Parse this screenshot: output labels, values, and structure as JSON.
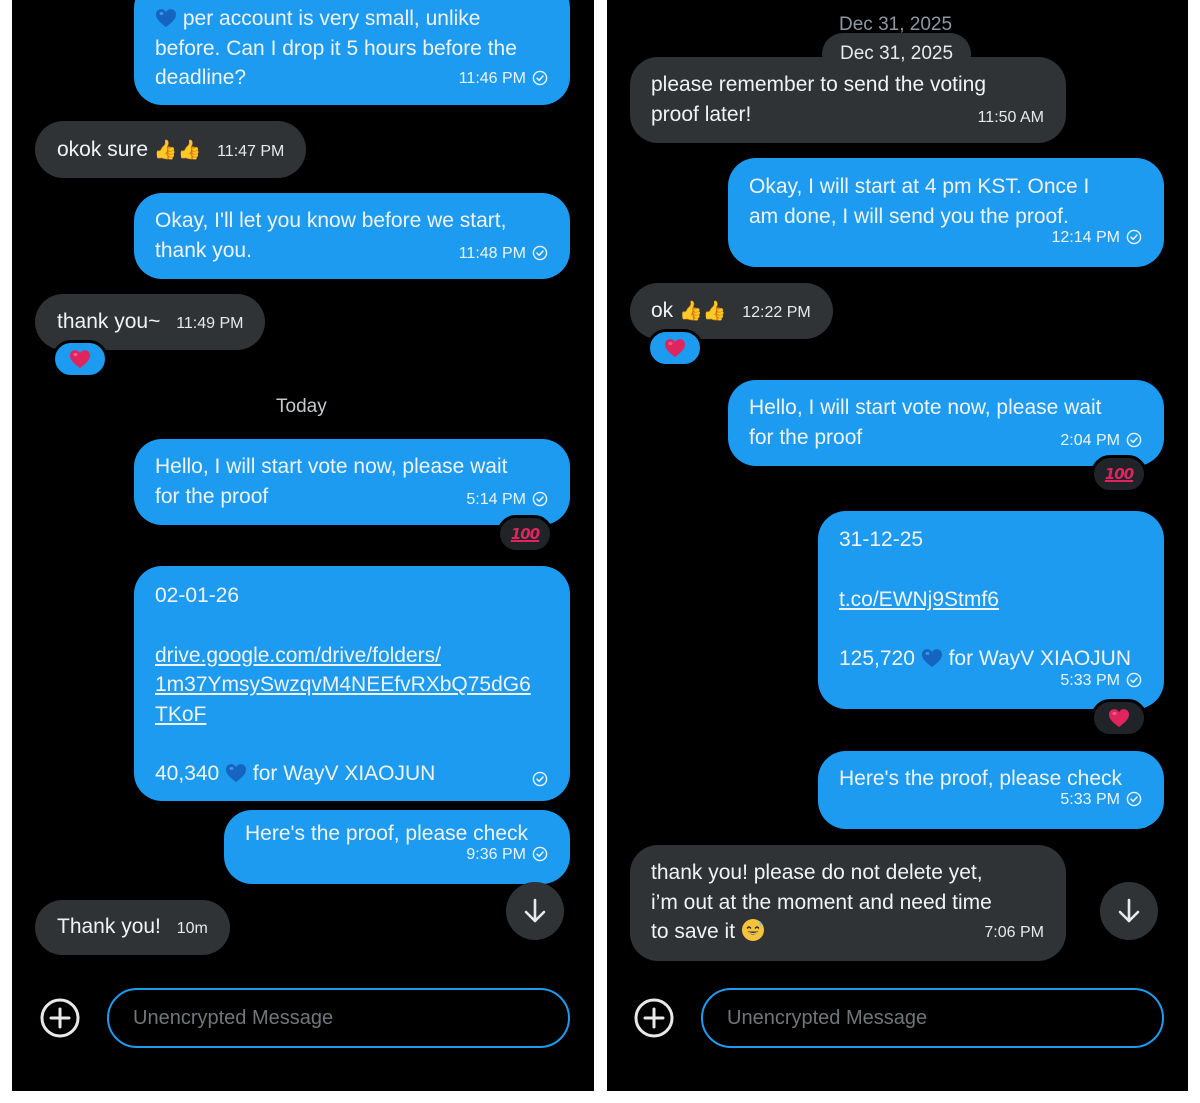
{
  "left": {
    "messages": [
      {
        "id": "l1",
        "dir": "out",
        "text_top": "💙 per account is very small, unlike\nbefore. Can I drop it 5 hours before the\ndeadline?",
        "time": "11:46 PM"
      },
      {
        "id": "l2",
        "dir": "in",
        "text": "okok sure 👍🏼👍🏼",
        "time": "11:47 PM"
      },
      {
        "id": "l3",
        "dir": "out",
        "text": "Okay, I'll let you know before we start,\nthank you.",
        "time": "11:48 PM"
      },
      {
        "id": "l4",
        "dir": "in",
        "text": "thank you~",
        "time": "11:49 PM",
        "reaction": "❤️"
      },
      {
        "id": "l5",
        "dir": "out",
        "text": "Hello, I will start vote now, please wait\nfor the proof",
        "time": "5:14 PM",
        "reaction": "💯"
      },
      {
        "id": "l6",
        "dir": "out",
        "date_line": "02-01-26",
        "link": "drive.google.com/drive/folders/\n1m37YmsySwzqvM4NEEfvRXbQ75dG6\nTKoF",
        "count_line": "40,340 💙 for WayV XIAOJUN"
      },
      {
        "id": "l7",
        "dir": "out",
        "text": "Here's the proof, please check",
        "time": "9:36 PM"
      },
      {
        "id": "l8",
        "dir": "in",
        "text": "Thank you!",
        "time": "10m"
      }
    ],
    "day_separator": "Today",
    "composer_placeholder": "Unencrypted Message"
  },
  "right": {
    "date_ghost": "Dec 31, 2025",
    "date_pill": "Dec 31, 2025",
    "messages": [
      {
        "id": "r1",
        "dir": "in",
        "text": "please remember to send the voting\nproof later!",
        "time": "11:50 AM"
      },
      {
        "id": "r2",
        "dir": "out",
        "text": "Okay, I will start at 4 pm KST. Once I\nam done, I will send you the proof.",
        "time": "12:14 PM"
      },
      {
        "id": "r3",
        "dir": "in",
        "text": "ok 👍🏼👍🏼",
        "time": "12:22 PM",
        "reaction": "❤️"
      },
      {
        "id": "r4",
        "dir": "out",
        "text": "Hello, I will start vote now, please wait\nfor the proof",
        "time": "2:04 PM",
        "reaction": "💯"
      },
      {
        "id": "r5",
        "dir": "out",
        "date_line": "31-12-25",
        "link": "t.co/EWNj9Stmf6",
        "count_line": "125,720 💙 for WayV XIAOJUN",
        "time": "5:33 PM",
        "reaction": "❤️"
      },
      {
        "id": "r6",
        "dir": "out",
        "text": "Here's the proof, please check",
        "time": "5:33 PM"
      },
      {
        "id": "r7",
        "dir": "in",
        "text": "thank you! please do not delete yet,\ni’m out at the moment and need time\nto save it 😅",
        "time": "7:06 PM"
      }
    ],
    "composer_placeholder": "Unencrypted Message"
  },
  "colors": {
    "outgoing": "#1d9bf0",
    "incoming": "#2f3336",
    "background": "#000000",
    "reaction_heart": "#e0245e"
  },
  "icons": [
    "check-circle-icon",
    "heart-icon",
    "hundred-points-icon",
    "arrow-down-icon",
    "plus-circle-icon",
    "blue-heart-icon",
    "thumbs-up-icon",
    "grinning-sweat-icon"
  ]
}
